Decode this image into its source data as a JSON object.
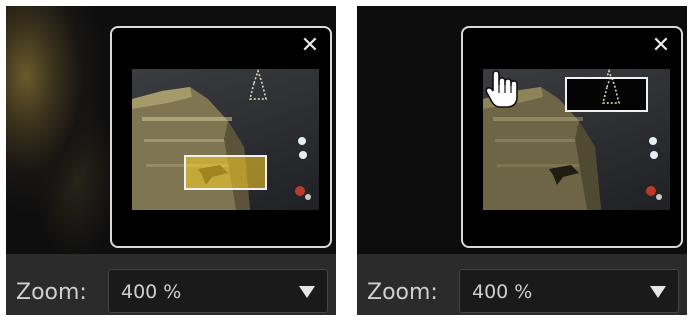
{
  "panels": [
    {
      "id": "before",
      "navigator": {
        "close_icon": "close-icon",
        "close_glyph": "✕"
      },
      "zoom": {
        "label": "Zoom:",
        "value": "400 %",
        "dropdown_icon": "chevron-down-icon"
      }
    },
    {
      "id": "after",
      "navigator": {
        "close_icon": "close-icon",
        "close_glyph": "✕"
      },
      "cursor_icon": "hand-cursor-icon",
      "zoom": {
        "label": "Zoom:",
        "value": "400 %",
        "dropdown_icon": "chevron-down-icon"
      }
    }
  ],
  "colors": {
    "navigator_border": "#d9d9d9",
    "view_rect_border": "#f0f0f0",
    "zoom_bar_bg": "#2b2b2b",
    "text": "#cfcfcf"
  }
}
